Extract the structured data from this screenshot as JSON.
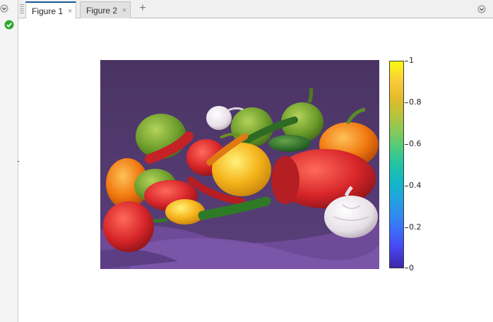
{
  "tabs": [
    {
      "label": "Figure 1",
      "active": true
    },
    {
      "label": "Figure 2",
      "active": false
    }
  ],
  "icons": {
    "tab_close": "×",
    "add_tab": "+",
    "menu": "chevron-down-circle-icon",
    "status": "check-circle-icon"
  },
  "colors": {
    "active_tab_accent": "#1a5a9a",
    "status_ok": "#2eaa2e",
    "colormap": "parula"
  },
  "colorbar": {
    "ticks": [
      "1",
      "0.8",
      "0.6",
      "0.4",
      "0.2",
      "0"
    ]
  }
}
